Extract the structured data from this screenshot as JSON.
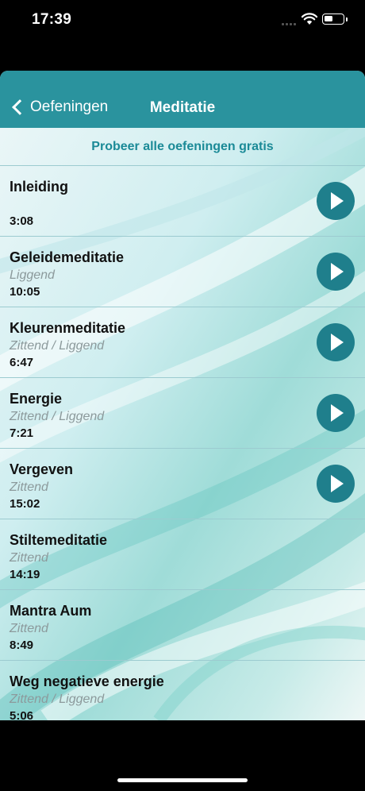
{
  "status_bar": {
    "time": "17:39"
  },
  "nav": {
    "back_label": "Oefeningen",
    "title": "Meditatie"
  },
  "promo": {
    "label": "Probeer alle oefeningen gratis"
  },
  "colors": {
    "accent": "#2a939e",
    "play": "#1f7f8c"
  },
  "exercises": [
    {
      "title": "Inleiding",
      "subtitle": "",
      "duration": "3:08",
      "playable": true
    },
    {
      "title": "Geleidemeditatie",
      "subtitle": "Liggend",
      "duration": "10:05",
      "playable": true
    },
    {
      "title": "Kleurenmeditatie",
      "subtitle": "Zittend / Liggend",
      "duration": "6:47",
      "playable": true
    },
    {
      "title": "Energie",
      "subtitle": "Zittend / Liggend",
      "duration": "7:21",
      "playable": true
    },
    {
      "title": "Vergeven",
      "subtitle": "Zittend",
      "duration": "15:02",
      "playable": true
    },
    {
      "title": "Stiltemeditatie",
      "subtitle": "Zittend",
      "duration": "14:19",
      "playable": false
    },
    {
      "title": "Mantra Aum",
      "subtitle": "Zittend",
      "duration": "8:49",
      "playable": false
    },
    {
      "title": "Weg negatieve energie",
      "subtitle": "Zittend / Liggend",
      "duration": "5:06",
      "playable": false
    }
  ]
}
